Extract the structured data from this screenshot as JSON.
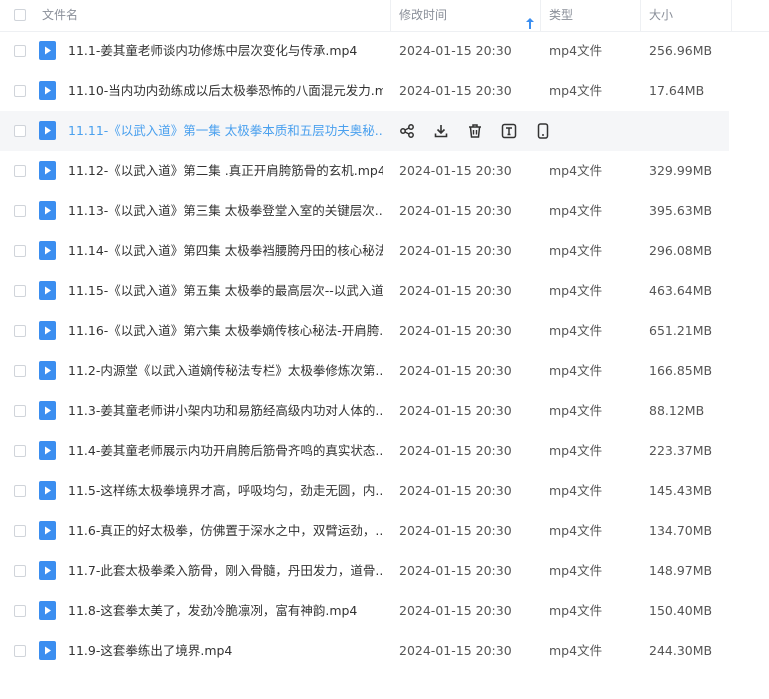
{
  "header": {
    "name": "文件名",
    "modified": "修改时间",
    "type": "类型",
    "size": "大小",
    "sort_icon": "arrow-up-icon"
  },
  "colors": {
    "accent": "#3b8ef0",
    "link_hover": "#4aa0ee",
    "row_hover_bg": "#f5f6f8"
  },
  "files": [
    {
      "name": "11.1-姜其童老师谈内功修炼中层次变化与传承.mp4",
      "date": "2024-01-15 20:30",
      "type": "mp4文件",
      "size": "256.96MB"
    },
    {
      "name": "11.10-当内功内劲练成以后太极拳恐怖的八面混元发力.m...",
      "date": "2024-01-15 20:30",
      "type": "mp4文件",
      "size": "17.64MB"
    },
    {
      "name": "11.11-《以武入道》第一集 太极拳本质和五层功夫奥秘....",
      "hover": true,
      "actions": [
        "share-icon",
        "download-icon",
        "delete-icon",
        "rename-icon",
        "phone-icon"
      ]
    },
    {
      "name": "11.12-《以武入道》第二集 .真正开肩胯筋骨的玄机.mp4",
      "date": "2024-01-15 20:30",
      "type": "mp4文件",
      "size": "329.99MB"
    },
    {
      "name": "11.13-《以武入道》第三集 太极拳登堂入室的关键层次...",
      "date": "2024-01-15 20:30",
      "type": "mp4文件",
      "size": "395.63MB"
    },
    {
      "name": "11.14-《以武入道》第四集 太极拳裆腰胯丹田的核心秘法...",
      "date": "2024-01-15 20:30",
      "type": "mp4文件",
      "size": "296.08MB"
    },
    {
      "name": "11.15-《以武入道》第五集 太极拳的最高层次--以武入道...",
      "date": "2024-01-15 20:30",
      "type": "mp4文件",
      "size": "463.64MB"
    },
    {
      "name": "11.16-《以武入道》第六集 太极拳嫡传核心秘法-开肩胯...",
      "date": "2024-01-15 20:30",
      "type": "mp4文件",
      "size": "651.21MB"
    },
    {
      "name": "11.2-内源堂《以武入道嫡传秘法专栏》太极拳修炼次第...",
      "date": "2024-01-15 20:30",
      "type": "mp4文件",
      "size": "166.85MB"
    },
    {
      "name": "11.3-姜其童老师讲小架内功和易筋经高级内功对人体的...",
      "date": "2024-01-15 20:30",
      "type": "mp4文件",
      "size": "88.12MB"
    },
    {
      "name": "11.4-姜其童老师展示内功开肩胯后筋骨齐鸣的真实状态...",
      "date": "2024-01-15 20:30",
      "type": "mp4文件",
      "size": "223.37MB"
    },
    {
      "name": "11.5-这样练太极拳境界才高，呼吸均匀，劲走无圆，内...",
      "date": "2024-01-15 20:30",
      "type": "mp4文件",
      "size": "145.43MB"
    },
    {
      "name": "11.6-真正的好太极拳，仿佛置于深水之中，双臂运劲，...",
      "date": "2024-01-15 20:30",
      "type": "mp4文件",
      "size": "134.70MB"
    },
    {
      "name": "11.7-此套太极拳柔入筋骨，刚入骨髓，丹田发力，道骨...",
      "date": "2024-01-15 20:30",
      "type": "mp4文件",
      "size": "148.97MB"
    },
    {
      "name": "11.8-这套拳太美了，发劲冷脆凛冽，富有神韵.mp4",
      "date": "2024-01-15 20:30",
      "type": "mp4文件",
      "size": "150.40MB"
    },
    {
      "name": "11.9-这套拳练出了境界.mp4",
      "date": "2024-01-15 20:30",
      "type": "mp4文件",
      "size": "244.30MB"
    }
  ]
}
